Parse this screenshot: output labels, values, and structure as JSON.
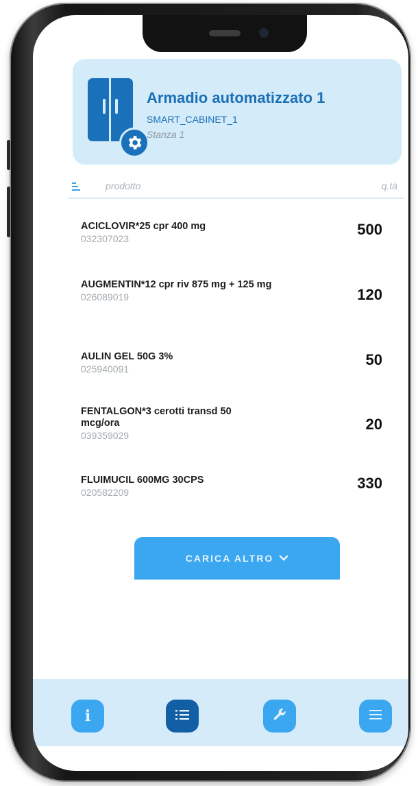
{
  "header": {
    "title": "Armadio automatizzato 1",
    "code": "SMART_CABINET_1",
    "room": "Stanza 1",
    "icon": "cabinet-gear-icon"
  },
  "columns": {
    "product": "prodotto",
    "quantity": "q.tà"
  },
  "products": [
    {
      "name": "ACICLOVIR*25 cpr 400 mg",
      "code": "032307023",
      "qty": "500"
    },
    {
      "name": "AUGMENTIN*12 cpr riv 875 mg + 125 mg",
      "code": "026089019",
      "qty": "120"
    },
    {
      "name": "AULIN GEL 50G 3%",
      "code": "025940091",
      "qty": "50"
    },
    {
      "name": "FENTALGON*3 cerotti transd 50 mcg/ora",
      "code": "039359029",
      "qty": "20"
    },
    {
      "name": "FLUIMUCIL 600MG 30CPS",
      "code": "020582209",
      "qty": "330"
    }
  ],
  "load_more": {
    "label": "CARICA ALTRO",
    "chevron": "∨"
  },
  "nav": {
    "info": {
      "icon": "info-icon",
      "glyph": "i"
    },
    "list": {
      "icon": "list-icon",
      "active": true
    },
    "tools": {
      "icon": "wrench-icon"
    },
    "menu": {
      "icon": "menu-icon"
    }
  },
  "colors": {
    "accent": "#3aa7f0",
    "accent_dark": "#135fa5",
    "header_bg": "#d4ebfa",
    "title": "#1b6fb5"
  }
}
